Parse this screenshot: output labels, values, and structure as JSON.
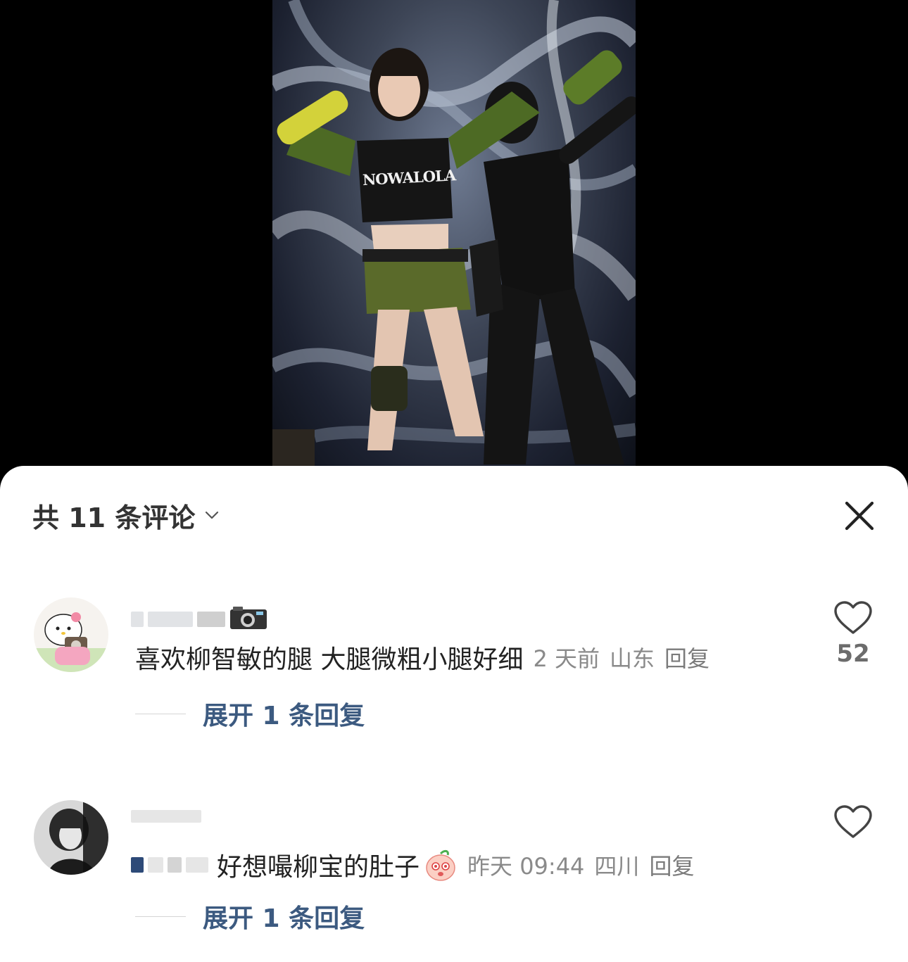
{
  "video": {
    "shirt_text": "NOWALOLA"
  },
  "comments_panel": {
    "title": "共 11 条评论",
    "close_icon": "close-icon",
    "dropdown_icon": "chevron-down-icon",
    "comments": [
      {
        "username_badge_icon": "camera-icon",
        "text": "喜欢柳智敏的腿 大腿微粗小腿好细",
        "time": "2 天前",
        "location": "山东",
        "reply_label": "回复",
        "like_count": "52",
        "like_icon": "heart-outline-icon",
        "expand_label": "展开 1 条回复"
      },
      {
        "text": "好想嘬柳宝的肚子",
        "emoji_icon": "peach-emoji-icon",
        "time": "昨天 09:44",
        "location": "四川",
        "reply_label": "回复",
        "like_count": "",
        "like_icon": "heart-outline-icon",
        "expand_label": "展开 1 条回复"
      }
    ]
  },
  "colors": {
    "expand_link": "#3c5a80",
    "meta_text": "#8a8a8a",
    "sheet_bg": "#ffffff",
    "video_bg": "#000000"
  }
}
